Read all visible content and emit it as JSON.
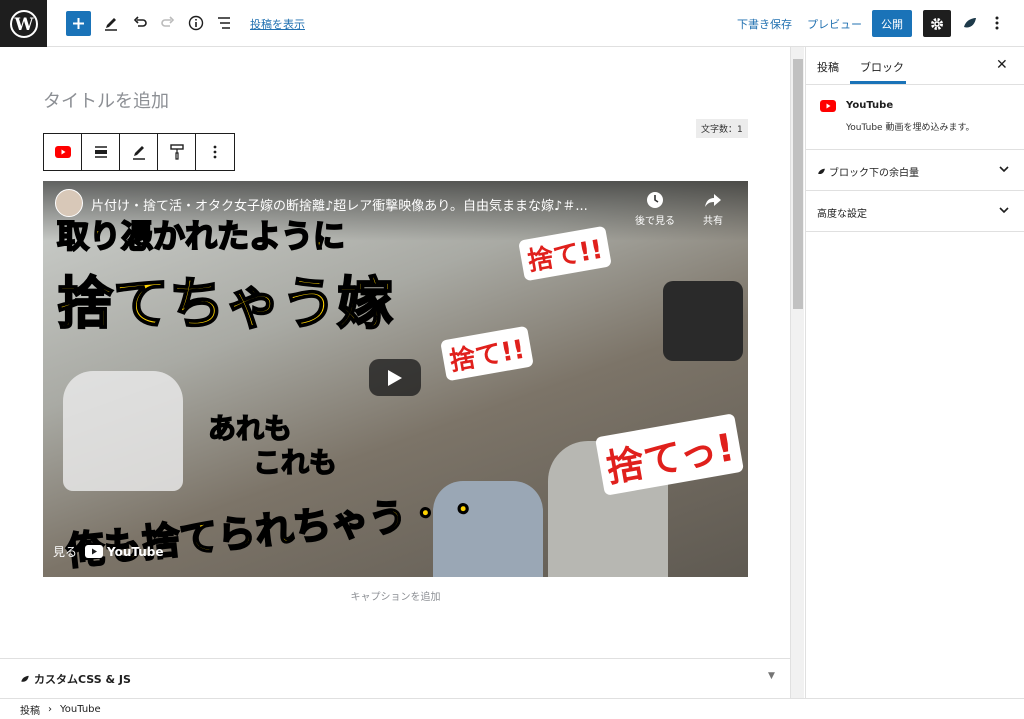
{
  "topbar": {
    "view_post_label": "投稿を表示",
    "save_draft_label": "下書き保存",
    "preview_label": "プレビュー",
    "publish_label": "公開"
  },
  "editor": {
    "title_placeholder": "タイトルを追加",
    "char_count": "文字数：1",
    "caption_placeholder": "キャプションを追加",
    "video": {
      "title": "片付け・捨て活・オタク女子嫁の断捨離♪超レア衝撃映像あり。自由気ままな嫁♪＃...",
      "watch_later_label": "後で見る",
      "share_label": "共有",
      "watch_label": "見る",
      "youtube_label": "YouTube",
      "thumb_text_1": "取り憑かれたように",
      "thumb_text_2": "捨てちゃう嫁",
      "thumb_text_3": "捨て!!",
      "thumb_text_4": "捨て!!",
      "thumb_text_5": "あれも",
      "thumb_text_6": "これも",
      "thumb_text_7": "捨てっ!",
      "thumb_text_8": "俺も捨てられちゃう・・"
    },
    "custom_panel_label": "カスタムCSS & JS"
  },
  "sidebar": {
    "tabs": [
      "投稿",
      "ブロック"
    ],
    "active_tab": "ブロック",
    "block_name": "YouTube",
    "block_description": "YouTube 動画を埋め込みます。",
    "accordions": [
      "ブロック下の余白量",
      "高度な設定"
    ]
  },
  "footer": {
    "breadcrumb": [
      "投稿",
      "YouTube"
    ]
  },
  "colors": {
    "accent": "#1a73b8",
    "dark": "#1e1e1e",
    "youtube_red": "#ff0000"
  }
}
